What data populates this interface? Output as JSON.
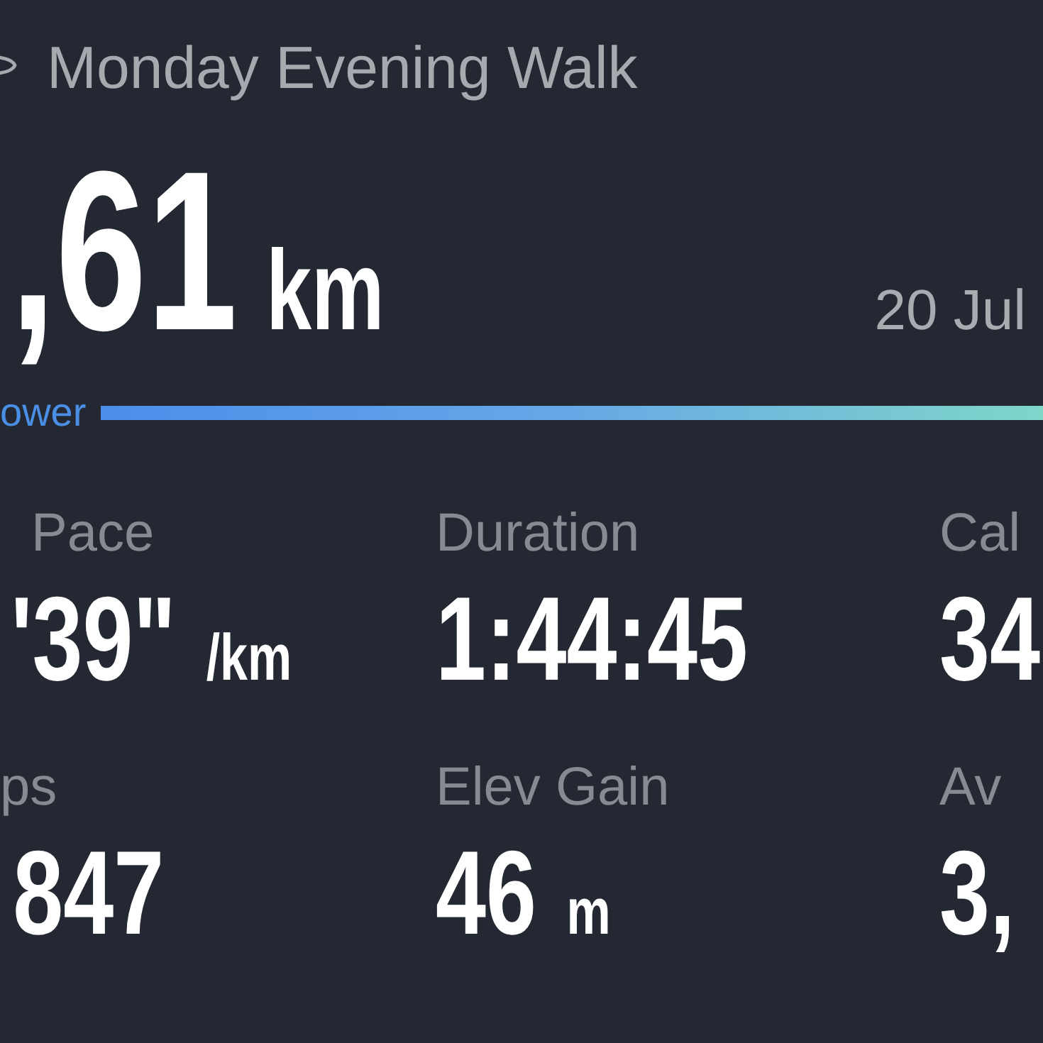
{
  "activity": {
    "title": "Monday Evening Walk"
  },
  "distance": {
    "value": ",61",
    "unit": "km",
    "date": "20 Jul"
  },
  "power_bar": {
    "label": "ower"
  },
  "stats": [
    {
      "label": "Pace",
      "value": "'39\"",
      "unit": "/km"
    },
    {
      "label": "Duration",
      "value": "1:44:45"
    },
    {
      "label": "Cal",
      "value": "34"
    },
    {
      "label": "ps",
      "value": "847"
    },
    {
      "label": "Elev Gain",
      "value": "46",
      "unit": "m"
    },
    {
      "label": "Av",
      "value": "3,"
    }
  ]
}
